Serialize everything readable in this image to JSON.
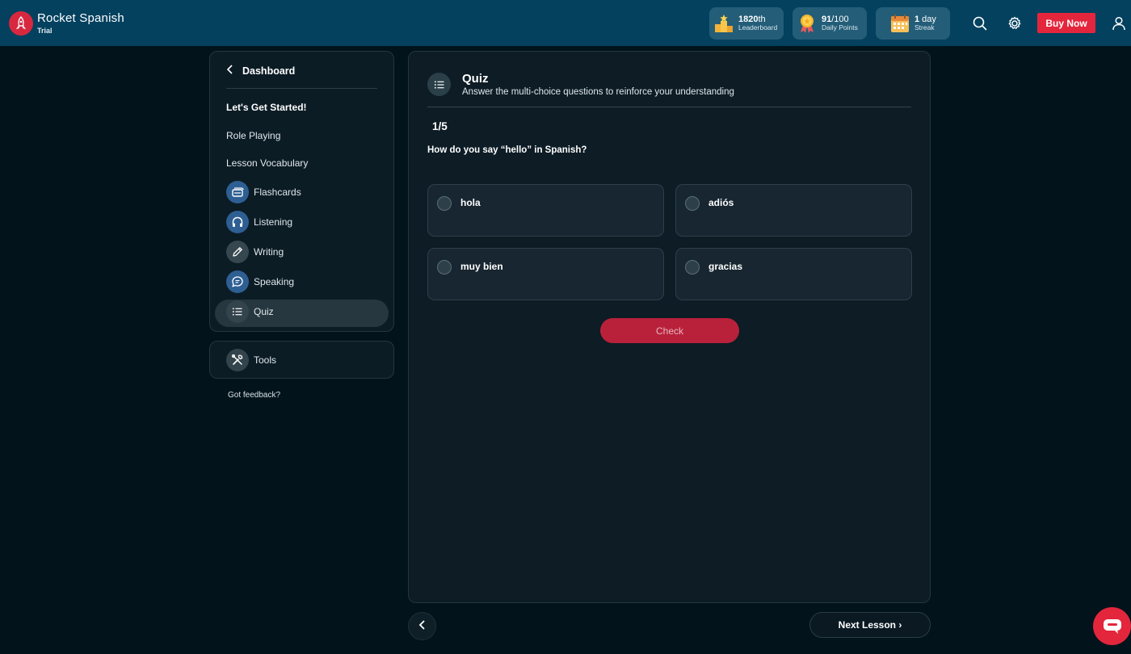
{
  "header": {
    "brand_name": "Rocket Spanish",
    "brand_sub": "Trial",
    "leaderboard": {
      "value": "1820",
      "suffix": "th",
      "label": "Leaderboard"
    },
    "daily_points": {
      "value": "91",
      "suffix": "/100",
      "label": "Daily Points"
    },
    "streak": {
      "value": "1",
      "suffix": " day",
      "label": "Streak"
    },
    "buy_label": "Buy Now",
    "icons": [
      "search-icon",
      "gear-icon",
      "user-icon"
    ]
  },
  "sidebar": {
    "dashboard_label": "Dashboard",
    "items": [
      {
        "label": "Let's Get Started!"
      },
      {
        "label": "Role Playing"
      },
      {
        "label": "Lesson Vocabulary"
      }
    ],
    "activities": [
      {
        "label": "Flashcards",
        "icon": "flashcards-icon"
      },
      {
        "label": "Listening",
        "icon": "headphones-icon"
      },
      {
        "label": "Writing",
        "icon": "pencil-icon"
      },
      {
        "label": "Speaking",
        "icon": "speech-bubble-icon"
      },
      {
        "label": "Quiz",
        "icon": "list-icon",
        "selected": true
      }
    ],
    "tools_label": "Tools",
    "feedback_label": "Got feedback?"
  },
  "main": {
    "title": "Quiz",
    "description": "Answer the multi-choice questions to reinforce your understanding",
    "progress": "1/5",
    "question": "How do you say “hello” in Spanish?",
    "options": [
      "hola",
      "adiós",
      "muy bien",
      "gracias"
    ],
    "check_label": "Check",
    "next_label": "Next Lesson ›"
  },
  "colors": {
    "header_bg": "#03415f",
    "page_bg": "#03131b",
    "accent_red": "#e3263c",
    "check_btn": "#b9213b"
  }
}
